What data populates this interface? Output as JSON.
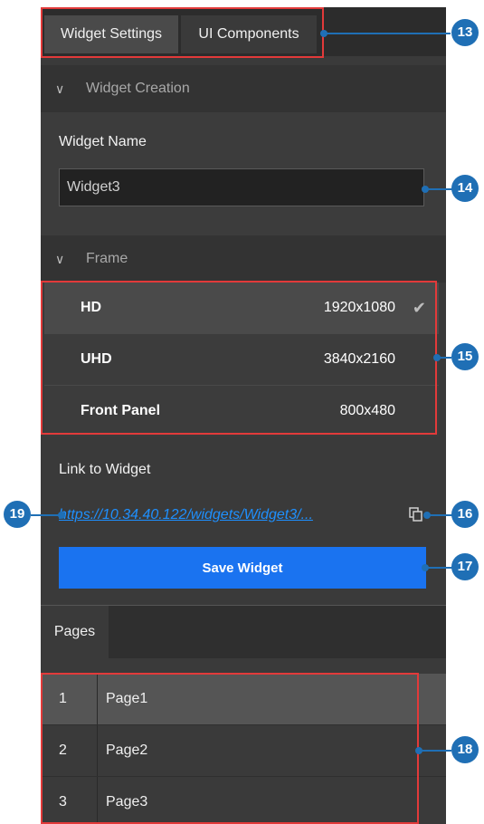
{
  "tabs": [
    "Widget Settings",
    "UI Components"
  ],
  "widget_creation": {
    "header": "Widget Creation",
    "name_label": "Widget Name",
    "name_value": "Widget3"
  },
  "frame": {
    "header": "Frame",
    "options": [
      {
        "name": "HD",
        "resolution": "1920x1080",
        "selected": true
      },
      {
        "name": "UHD",
        "resolution": "3840x2160",
        "selected": false
      },
      {
        "name": "Front Panel",
        "resolution": "800x480",
        "selected": false
      }
    ]
  },
  "link_section": {
    "label": "Link to Widget",
    "url": "https://10.34.40.122/widgets/Widget3/..."
  },
  "save_button": "Save Widget",
  "pages": {
    "tab_label": "Pages",
    "rows": [
      {
        "num": "1",
        "name": "Page1"
      },
      {
        "num": "2",
        "name": "Page2"
      },
      {
        "num": "3",
        "name": "Page3"
      }
    ]
  },
  "callouts": {
    "c13": "13",
    "c14": "14",
    "c15": "15",
    "c16": "16",
    "c17": "17",
    "c18": "18",
    "c19": "19"
  },
  "colors": {
    "accent": "#1a73f0",
    "callout": "#1f6fb5",
    "highlight": "#e23a3a",
    "link": "#1e90ff"
  },
  "icons": {
    "chevron": "chevron-down-icon",
    "check": "check-icon",
    "copy": "copy-icon"
  }
}
